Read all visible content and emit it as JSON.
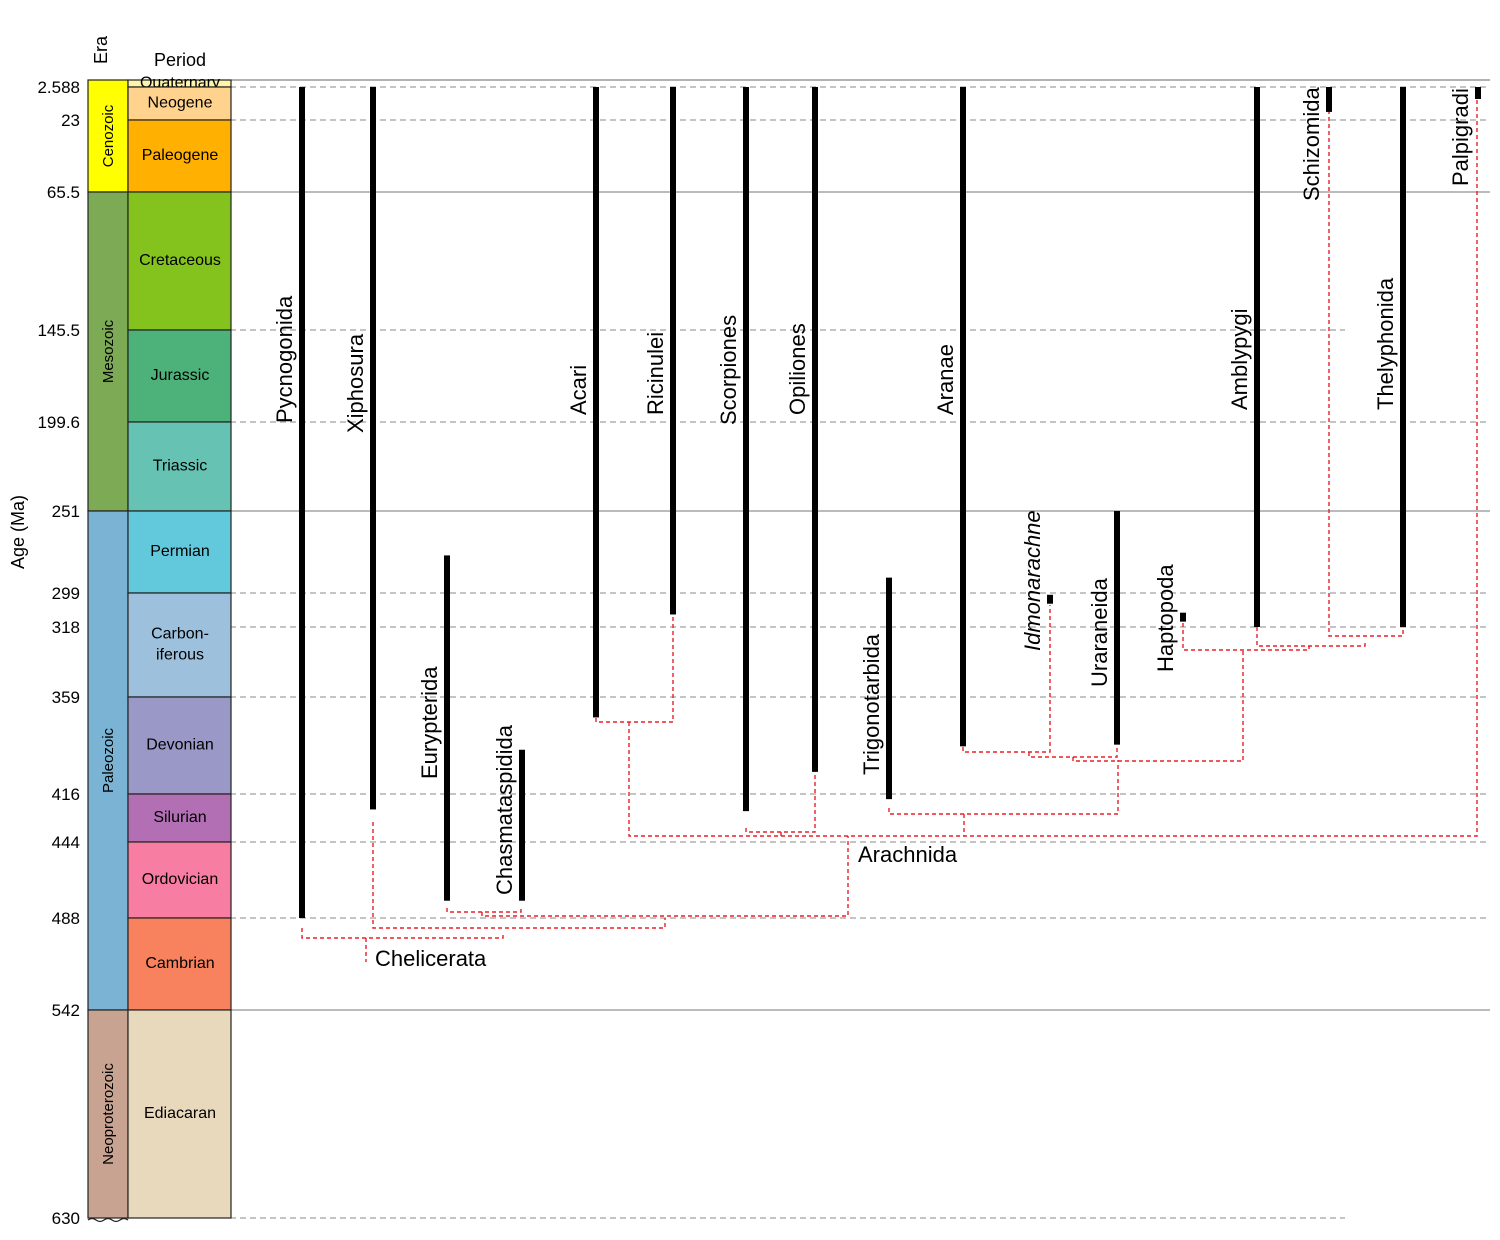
{
  "header": {
    "era_title": "Era",
    "period_title": "Period",
    "y_axis_label": "Age (Ma)"
  },
  "ticks": [
    {
      "label": "2.588",
      "value": 2.588
    },
    {
      "label": "23",
      "value": 23
    },
    {
      "label": "65.5",
      "value": 65.5
    },
    {
      "label": "145.5",
      "value": 145.5
    },
    {
      "label": "199.6",
      "value": 199.6
    },
    {
      "label": "251",
      "value": 251
    },
    {
      "label": "299",
      "value": 299
    },
    {
      "label": "318",
      "value": 318
    },
    {
      "label": "359",
      "value": 359
    },
    {
      "label": "416",
      "value": 416
    },
    {
      "label": "444",
      "value": 444
    },
    {
      "label": "488",
      "value": 488
    },
    {
      "label": "542",
      "value": 542
    },
    {
      "label": "630",
      "value": 630
    }
  ],
  "eras": [
    {
      "name": "Cenozoic",
      "from": 0,
      "to": 65.5,
      "color": "#ffff00"
    },
    {
      "name": "Mesozoic",
      "from": 65.5,
      "to": 251,
      "color": "#7daa55"
    },
    {
      "name": "Paleozoic",
      "from": 251,
      "to": 542,
      "color": "#7ab3d4"
    },
    {
      "name": "Neoproterozoic",
      "from": 542,
      "to": 630,
      "color": "#c8a391"
    }
  ],
  "periods": [
    {
      "lines": [
        "Quaternary"
      ],
      "from": 0,
      "to": 2.588,
      "color": "#fff5a8"
    },
    {
      "lines": [
        "Neogene"
      ],
      "from": 2.588,
      "to": 23,
      "color": "#ffd38e"
    },
    {
      "lines": [
        "Paleogene"
      ],
      "from": 23,
      "to": 65.5,
      "color": "#ffb000"
    },
    {
      "lines": [
        "Cretaceous"
      ],
      "from": 65.5,
      "to": 145.5,
      "color": "#84c31e"
    },
    {
      "lines": [
        "Jurassic"
      ],
      "from": 145.5,
      "to": 199.6,
      "color": "#4db27a"
    },
    {
      "lines": [
        "Triassic"
      ],
      "from": 199.6,
      "to": 251,
      "color": "#66c3b3"
    },
    {
      "lines": [
        "Permian"
      ],
      "from": 251,
      "to": 299,
      "color": "#62c8dc"
    },
    {
      "lines": [
        "Carbon-",
        "iferous"
      ],
      "from": 299,
      "to": 359,
      "color": "#9dc0dc"
    },
    {
      "lines": [
        "Devonian"
      ],
      "from": 359,
      "to": 416,
      "color": "#9a98c6"
    },
    {
      "lines": [
        "Silurian"
      ],
      "from": 416,
      "to": 444,
      "color": "#b36fb3"
    },
    {
      "lines": [
        "Ordovician"
      ],
      "from": 444,
      "to": 488,
      "color": "#f77ea2"
    },
    {
      "lines": [
        "Cambrian"
      ],
      "from": 488,
      "to": 542,
      "color": "#f8825e"
    },
    {
      "lines": [
        "Ediacaran"
      ],
      "from": 542,
      "to": 630,
      "color": "#e8d8bc"
    }
  ],
  "taxa": [
    {
      "name": "Pycnogonida",
      "range": [
        2.588,
        488
      ],
      "italic": false
    },
    {
      "name": "Xiphosura",
      "range": [
        2.588,
        425
      ],
      "italic": false
    },
    {
      "name": "Eurypterida",
      "range": [
        277,
        478
      ],
      "italic": false
    },
    {
      "name": "Chasmataspidida",
      "range": [
        390,
        478
      ],
      "italic": false
    },
    {
      "name": "Acari",
      "range": [
        2.588,
        371
      ],
      "italic": false
    },
    {
      "name": "Ricinulei",
      "range": [
        2.588,
        311
      ],
      "italic": false
    },
    {
      "name": "Scorpiones",
      "range": [
        2.588,
        426
      ],
      "italic": false
    },
    {
      "name": "Opiliones",
      "range": [
        2.588,
        403
      ],
      "italic": false
    },
    {
      "name": "Trigonotarbida",
      "range": [
        290,
        419
      ],
      "italic": false
    },
    {
      "name": "Aranae",
      "range": [
        2.588,
        388
      ],
      "italic": false
    },
    {
      "name": "Idmonarachne",
      "range": [
        300,
        305
      ],
      "italic": true
    },
    {
      "name": "Uraraneida",
      "range": [
        251,
        387
      ],
      "italic": false
    },
    {
      "name": "Haptopoda",
      "range": [
        310,
        315
      ],
      "italic": false
    },
    {
      "name": "Amblypygi",
      "range": [
        2.588,
        318
      ],
      "italic": false
    },
    {
      "name": "Schizomida",
      "range": [
        2.588,
        18
      ],
      "italic": false
    },
    {
      "name": "Thelyphonida",
      "range": [
        2.588,
        318
      ],
      "italic": false
    },
    {
      "name": "Palpigradi",
      "range": [
        2.588,
        10
      ],
      "italic": false
    }
  ],
  "clades": {
    "chelicerata": "Chelicerata",
    "arachnida": "Arachnida"
  },
  "colors": {
    "range_bar": "#000000",
    "phylogeny": "#e8202a",
    "gridline": "#888888"
  }
}
